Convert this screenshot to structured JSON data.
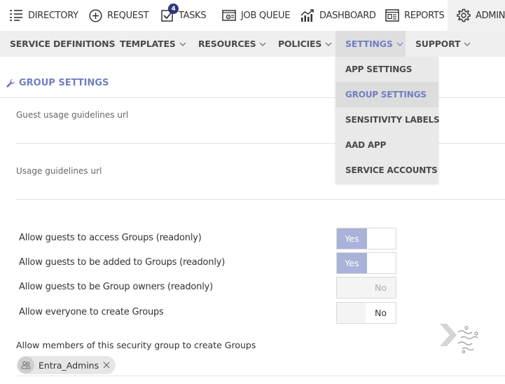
{
  "topnav": {
    "items": [
      {
        "label": "DIRECTORY",
        "icon": "list-icon"
      },
      {
        "label": "REQUEST",
        "icon": "plus-circle-icon"
      },
      {
        "label": "TASKS",
        "icon": "checkbox-icon",
        "badge": "4"
      },
      {
        "label": "JOB QUEUE",
        "icon": "job-queue-icon"
      },
      {
        "label": "DASHBOARD",
        "icon": "chart-icon"
      },
      {
        "label": "REPORTS",
        "icon": "report-icon"
      },
      {
        "label": "ADMIN",
        "icon": "gear-icon",
        "active": true
      }
    ]
  },
  "subnav": {
    "items": [
      {
        "label": "SERVICE DEFINITIONS"
      },
      {
        "label": "TEMPLATES"
      },
      {
        "label": "RESOURCES"
      },
      {
        "label": "POLICIES"
      },
      {
        "label": "SETTINGS",
        "active": true
      },
      {
        "label": "SUPPORT"
      }
    ]
  },
  "dropdown": {
    "items": [
      {
        "label": "APP SETTINGS"
      },
      {
        "label": "GROUP SETTINGS",
        "active": true
      },
      {
        "label": "SENSITIVITY LABELS"
      },
      {
        "label": "AAD APP"
      },
      {
        "label": "SERVICE ACCOUNTS"
      }
    ]
  },
  "page": {
    "title": "GROUP SETTINGS",
    "guest_url_label": "Guest usage guidelines url",
    "usage_url_label": "Usage guidelines url",
    "settings": [
      {
        "label": "Allow guests to access Groups (readonly)",
        "value": "Yes",
        "state": "on"
      },
      {
        "label": "Allow guests to be added to Groups (readonly)",
        "value": "Yes",
        "state": "on"
      },
      {
        "label": "Allow guests to be Group owners (readonly)",
        "value": "No",
        "state": "off-disabled"
      },
      {
        "label": "Allow everyone to create Groups",
        "value": "No",
        "state": "off"
      }
    ],
    "security_group_label": "Allow members of this security group to create Groups",
    "chip_label": "Entra_Admins"
  },
  "colors": {
    "accent": "#6f7fc0",
    "toggle_on": "#a9b2d8",
    "badge": "#2c3678"
  }
}
